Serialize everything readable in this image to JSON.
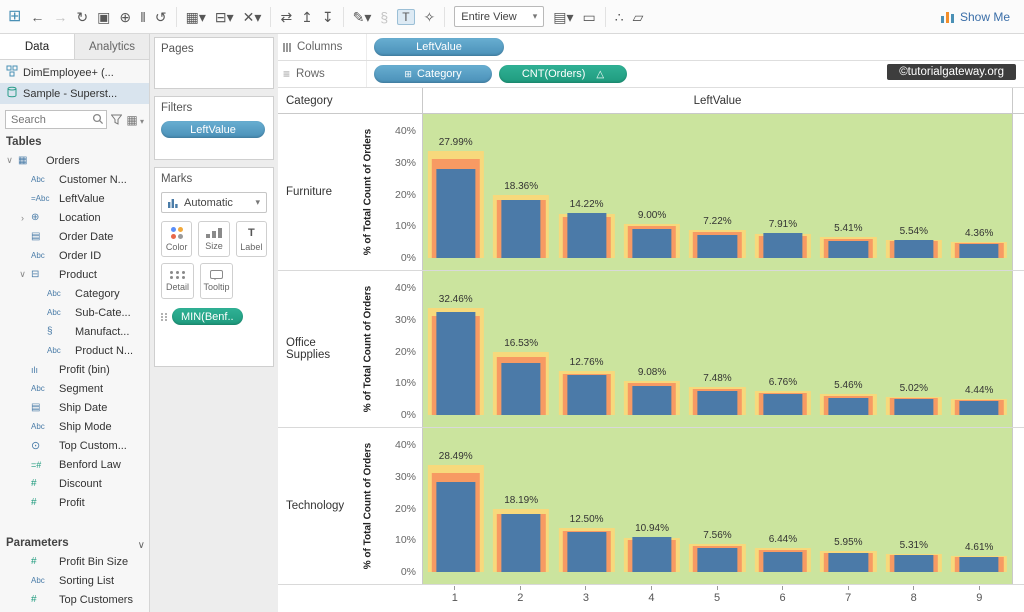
{
  "toolbar": {
    "left_icons": [
      "tableau-logo",
      "back-arrow",
      "forward-arrow",
      "redo",
      "save",
      "add-datasource",
      "pause-updates",
      "refresh-data",
      "divider",
      "new-worksheet",
      "duplicate-sheet",
      "clear-sheet",
      "divider",
      "swap-rows-columns",
      "sort-ascending",
      "sort-descending",
      "divider",
      "highlight",
      "group-members",
      "show-mark-labels",
      "fix-axes",
      "divider"
    ],
    "right_icons": [
      "show-hide-cards",
      "presentation-mode",
      "divider",
      "share-workbook",
      "tooltip-mode"
    ],
    "fit_selector": "Entire View",
    "show_me_label": "Show Me"
  },
  "data_pane": {
    "tabs": [
      {
        "label": "Data",
        "active": true
      },
      {
        "label": "Analytics",
        "active": false
      }
    ],
    "datasources": [
      {
        "label": "DimEmployee+ (...",
        "icon": "cube-datasource-icon",
        "selected": false
      },
      {
        "label": "Sample - Superst...",
        "icon": "database-icon",
        "selected": true
      }
    ],
    "search_placeholder": "Search",
    "tables_label": "Tables",
    "tree": [
      {
        "label": "Orders",
        "type": "table",
        "level": 0,
        "expander": "down"
      },
      {
        "label": "Customer N...",
        "type": "text",
        "level": 1
      },
      {
        "label": "LeftValue",
        "type": "calc-text",
        "level": 1
      },
      {
        "label": "Location",
        "type": "hierarchy",
        "level": 1,
        "expander": "right"
      },
      {
        "label": "Order Date",
        "type": "date",
        "level": 1
      },
      {
        "label": "Order ID",
        "type": "text",
        "level": 1
      },
      {
        "label": "Product",
        "type": "hierarchy-open",
        "level": 1,
        "expander": "down"
      },
      {
        "label": "Category",
        "type": "text",
        "level": 2
      },
      {
        "label": "Sub-Cate...",
        "type": "text",
        "level": 2
      },
      {
        "label": "Manufact...",
        "type": "attribute",
        "level": 2
      },
      {
        "label": "Product N...",
        "type": "text",
        "level": 2
      },
      {
        "label": "Profit (bin)",
        "type": "bin",
        "level": 1
      },
      {
        "label": "Segment",
        "type": "text",
        "level": 1
      },
      {
        "label": "Ship Date",
        "type": "date",
        "level": 1
      },
      {
        "label": "Ship Mode",
        "type": "text",
        "level": 1
      },
      {
        "label": "Top Custom...",
        "type": "set",
        "level": 1
      },
      {
        "label": "Benford Law",
        "type": "calc-numeric",
        "level": 1
      },
      {
        "label": "Discount",
        "type": "numeric",
        "level": 1
      },
      {
        "label": "Profit",
        "type": "numeric",
        "level": 1
      }
    ],
    "parameters_label": "Parameters",
    "parameters": [
      {
        "label": "Profit Bin Size",
        "type": "numeric"
      },
      {
        "label": "Sorting List",
        "type": "text"
      },
      {
        "label": "Top Customers",
        "type": "numeric"
      }
    ]
  },
  "cards": {
    "pages_label": "Pages",
    "filters_label": "Filters",
    "filter_pills": [
      {
        "label": "LeftValue",
        "color": "blue"
      }
    ],
    "marks": {
      "label": "Marks",
      "mark_type": "Automatic",
      "buttons_row1": [
        {
          "label": "Color"
        },
        {
          "label": "Size"
        },
        {
          "label": "Label"
        }
      ],
      "buttons_row2": [
        {
          "label": "Detail"
        },
        {
          "label": "Tooltip"
        }
      ],
      "pills": [
        {
          "label": "MIN(Benf..",
          "color": "green"
        }
      ]
    }
  },
  "shelves": {
    "columns_label": "Columns",
    "columns_pills": [
      {
        "label": "LeftValue",
        "color": "blue"
      }
    ],
    "rows_label": "Rows",
    "rows_pills": [
      {
        "label": "Category",
        "color": "blue",
        "icon": "table"
      },
      {
        "label": "CNT(Orders)",
        "color": "green",
        "warning": true
      }
    ]
  },
  "watermark": "©tutorialgateway.org",
  "chart_data": {
    "type": "bar",
    "title": "LeftValue",
    "row_dimension": "Category",
    "x": [
      1,
      2,
      3,
      4,
      5,
      6,
      7,
      8,
      9
    ],
    "ylabel": "% of Total Count of Orders",
    "ylim": [
      0,
      40
    ],
    "yticks": [
      0,
      10,
      20,
      30,
      40
    ],
    "ytick_suffix": "%",
    "grid": false,
    "series": [
      {
        "name": "Furniture",
        "values": [
          27.99,
          18.36,
          14.22,
          9.0,
          7.22,
          7.91,
          5.41,
          5.54,
          4.36
        ]
      },
      {
        "name": "Office Supplies",
        "values": [
          32.46,
          16.53,
          12.76,
          9.08,
          7.48,
          6.76,
          5.46,
          5.02,
          4.44
        ]
      },
      {
        "name": "Technology",
        "values": [
          28.49,
          18.19,
          12.5,
          10.94,
          7.56,
          6.44,
          5.95,
          5.31,
          4.61
        ]
      }
    ],
    "reference_bands": {
      "benford_expected": [
        30.1,
        17.6,
        12.5,
        9.7,
        7.9,
        6.7,
        5.8,
        5.1,
        4.6
      ],
      "outer_color": "#f7d97c",
      "inner_color": "#f79a63"
    },
    "colors": {
      "bar": "#4b7aa8",
      "plot_bg": "#cbe49e"
    }
  }
}
